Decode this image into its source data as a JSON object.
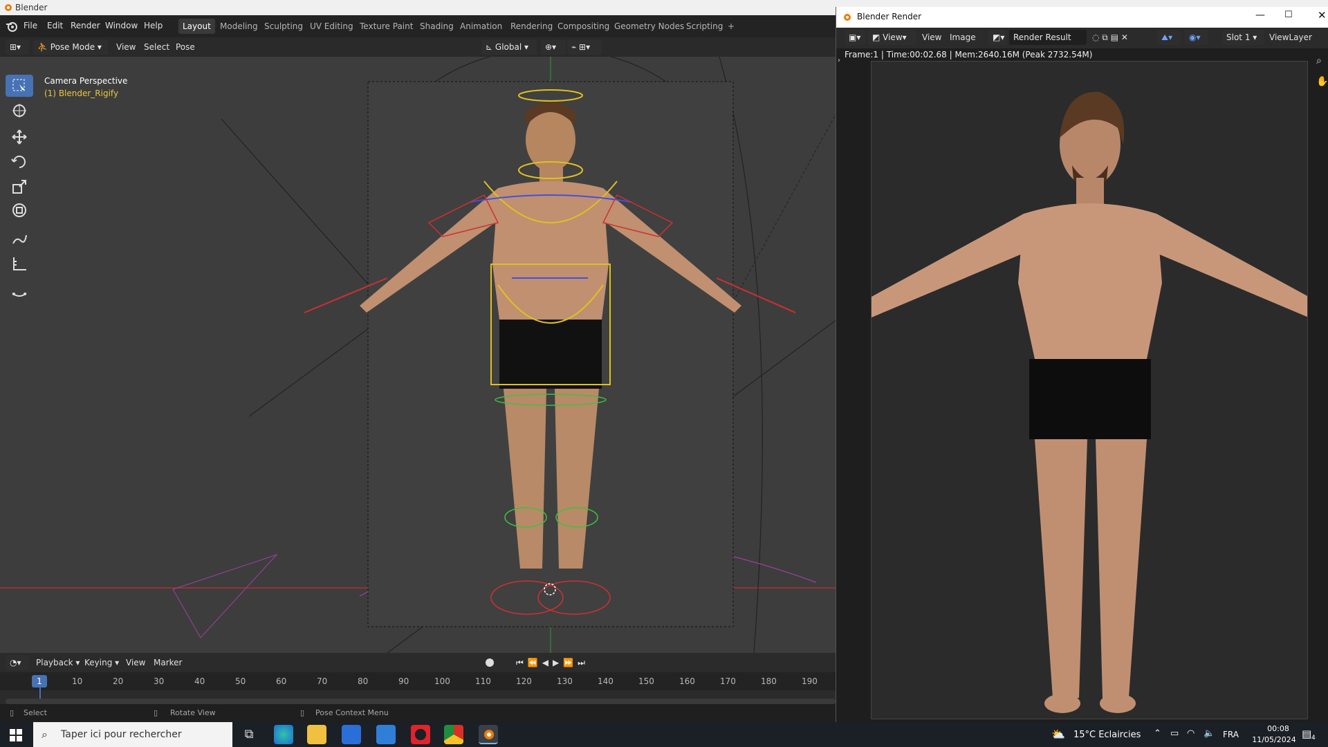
{
  "os": {
    "window_title": "Blender"
  },
  "menu": {
    "items": [
      "File",
      "Edit",
      "Render",
      "Window",
      "Help"
    ]
  },
  "workspaces": [
    "Layout",
    "Modeling",
    "Sculpting",
    "UV Editing",
    "Texture Paint",
    "Shading",
    "Animation",
    "Rendering",
    "Compositing",
    "Geometry Nodes",
    "Scripting",
    "+"
  ],
  "viewport_header": {
    "mode": "Pose Mode",
    "menus": [
      "View",
      "Select",
      "Pose"
    ],
    "transform_orientation": "Global"
  },
  "viewport": {
    "camera_label": "Camera Perspective",
    "object_label": "(1) Blender_Rigify"
  },
  "timeline": {
    "menus": [
      "Playback",
      "Keying",
      "View",
      "Marker"
    ],
    "current_frame": "1",
    "ticks": [
      "10",
      "20",
      "30",
      "40",
      "50",
      "60",
      "70",
      "80",
      "90",
      "100",
      "110",
      "120",
      "130",
      "140",
      "150",
      "160",
      "170",
      "180",
      "190"
    ]
  },
  "statusbar": {
    "select": "Select",
    "rotate": "Rotate View",
    "context": "Pose Context Menu"
  },
  "render_window": {
    "title": "Blender Render",
    "header_menus": [
      "View",
      "View",
      "Image"
    ],
    "image_name": "Render Result",
    "slot": "Slot 1",
    "view_layer": "ViewLayer",
    "info": "Frame:1 | Time:00:02.68 | Mem:2640.16M (Peak 2732.54M)"
  },
  "taskbar": {
    "search_placeholder": "Taper ici pour rechercher",
    "weather": "15°C  Eclaircies",
    "language": "FRA",
    "time": "00:08",
    "date": "11/05/2024",
    "notification_count": "4"
  },
  "colors": {
    "accent": "#4772b3",
    "rig_yellow": "#e0c020",
    "rig_green": "#40c040",
    "rig_red": "#d03030",
    "rig_blue": "#4050e0",
    "rig_pink": "#c040c0"
  }
}
